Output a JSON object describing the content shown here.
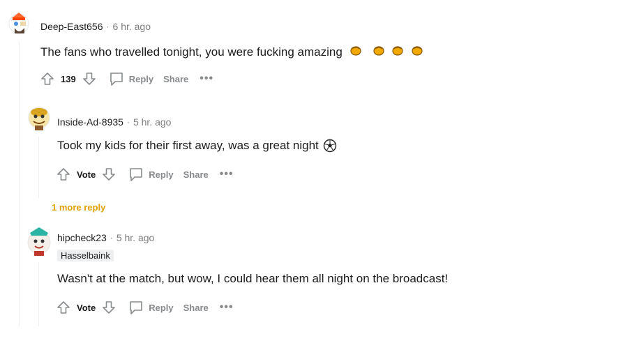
{
  "comments": [
    {
      "author": "Deep-East656",
      "time": "6 hr. ago",
      "text": "The fans who travelled tonight, you were fucking amazing",
      "emoji_icons": [
        "clapping-hands-icon",
        "clapping-hands-icon",
        "clapping-hands-icon",
        "clapping-hands-icon"
      ],
      "score": "139",
      "reply_label": "Reply",
      "share_label": "Share",
      "more_label": "•••"
    },
    {
      "author": "Inside-Ad-8935",
      "time": "5 hr. ago",
      "text": "Took my kids for their first away, was a great night",
      "emoji_icons": [
        "soccer-ball-icon"
      ],
      "score": "Vote",
      "reply_label": "Reply",
      "share_label": "Share",
      "more_label": "•••"
    },
    {
      "author": "hipcheck23",
      "time": "5 hr. ago",
      "flair": "Hasselbaink",
      "text": "Wasn't at the match, but wow, I could hear them all night on the broadcast!",
      "score": "Vote",
      "reply_label": "Reply",
      "share_label": "Share",
      "more_label": "•••"
    }
  ],
  "more_replies_label": "1 more reply",
  "meta_separator": "·",
  "colors": {
    "more_replies": "#e0a100",
    "muted": "#878a8c",
    "text": "#1c1c1c",
    "thread_line": "#edeff1"
  }
}
